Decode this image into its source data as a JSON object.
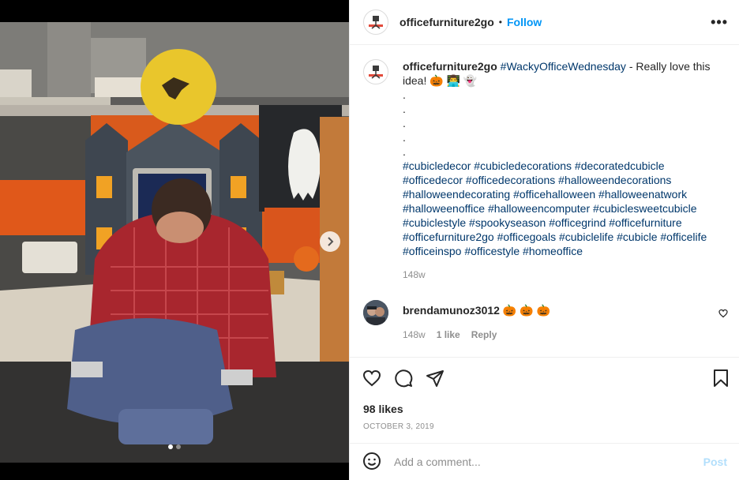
{
  "post": {
    "account": "officefurniture2go",
    "follow_label": "Follow",
    "separator": "•",
    "more_label": "•••",
    "caption": {
      "username": "officefurniture2go",
      "hashtag_main": "#WackyOfficeWednesday",
      "text": " - Really love this idea! 🎃 👨‍💻 👻",
      "dots": [
        ".",
        ".",
        ".",
        ".",
        "."
      ],
      "hashtags": [
        "#cubicledecor",
        "#cubicledecorations",
        "#decoratedcubicle",
        "#officedecor",
        "#officedecorations",
        "#halloweendecorations",
        "#halloweendecorating",
        "#officehalloween",
        "#halloweenatwork",
        "#halloweenoffice",
        "#halloweencomputer",
        "#cubiclesweetcubicle",
        "#cubiclestyle",
        "#spookyseason",
        "#officegrind",
        "#officefurniture",
        "#officefurniture2go",
        "#officegoals",
        "#cubiclelife",
        "#cubicle",
        "#officelife",
        "#officeinspo",
        "#officestyle",
        "#homeoffice"
      ],
      "time": "148w"
    },
    "comment": {
      "username": "brendamunoz3012",
      "text": "🎃 🎃 🎃",
      "time": "148w",
      "likes": "1 like",
      "reply": "Reply"
    },
    "likes": "98 likes",
    "date": "OCTOBER 3, 2019",
    "add_comment_placeholder": "Add a comment...",
    "post_button": "Post",
    "carousel": {
      "current": 1,
      "total": 2
    }
  },
  "colors": {
    "link_blue": "#0095f6",
    "hashtag": "#00376b",
    "muted": "#8e8e8e",
    "post_disabled": "#b2dffc"
  },
  "icons": [
    "chevron-right-icon",
    "more-icon",
    "heart-icon",
    "comment-icon",
    "share-icon",
    "bookmark-icon",
    "emoji-icon",
    "small-heart-icon"
  ]
}
